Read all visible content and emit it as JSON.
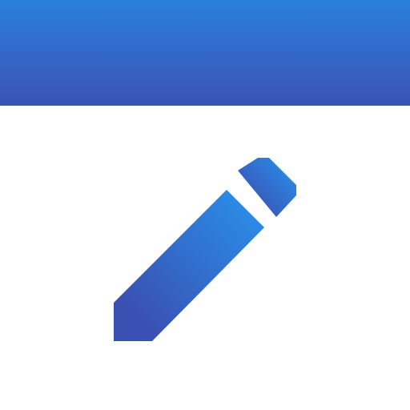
{
  "icon": {
    "name": "pencil-icon",
    "description_label": ""
  },
  "colors": {
    "background": "#ffffff",
    "band_top": "#2b7fdc",
    "band_bottom": "#3a53b5",
    "pencil_light": "#2a8ee9",
    "pencil_dark": "#3a50b2"
  }
}
